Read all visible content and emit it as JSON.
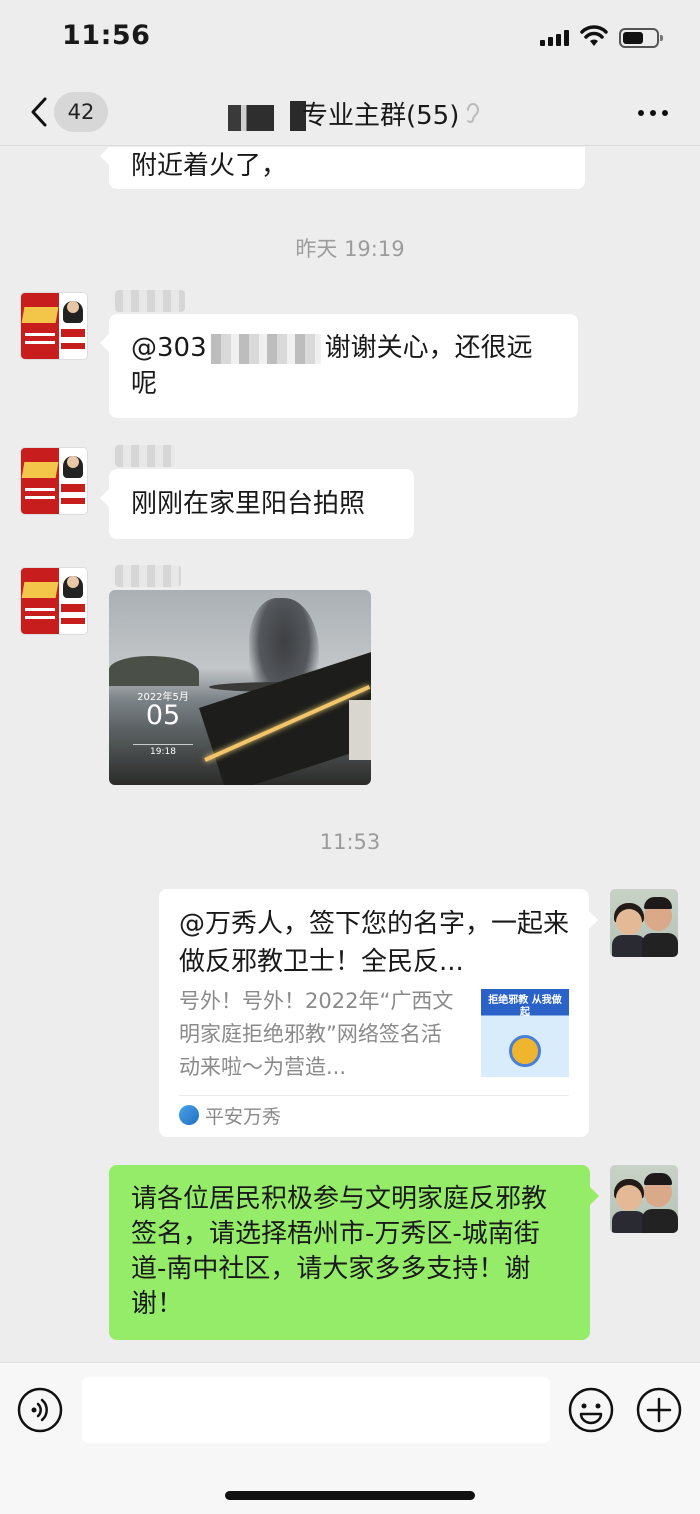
{
  "status_bar": {
    "time": "11:56"
  },
  "nav": {
    "unread_count": "42",
    "title": "专业主群(55)"
  },
  "messages": {
    "prev_tail": "附近着火了，",
    "ts1": "昨天 19:19",
    "m1_prefix": "@303",
    "m1_suffix": "谢谢关心，还很远",
    "m1_line2": "呢",
    "m2": "刚刚在家里阳台拍照",
    "photo_watermark": {
      "date": "2022年5月",
      "day": "05",
      "time": "19:18"
    },
    "ts2": "11:53",
    "card": {
      "title": "@万秀人，签下您的名字，一起来做反邪教卫士！全民反...",
      "desc": "号外！号外！2022年“广西文明家庭拒绝邪教”网络签名活动来啦～为营造...",
      "thumb_text": "拒绝邪教 从我做起",
      "source": "平安万秀"
    },
    "m3": "请各位居民积极参与文明家庭反邪教签名，请选择梧州市-万秀区-城南街道-南中社区，请大家多多支持！谢谢！"
  },
  "input_bar": {
    "placeholder": ""
  },
  "colors": {
    "background": "#ededed",
    "sent_bubble": "#95ec69",
    "received_bubble": "#ffffff"
  }
}
